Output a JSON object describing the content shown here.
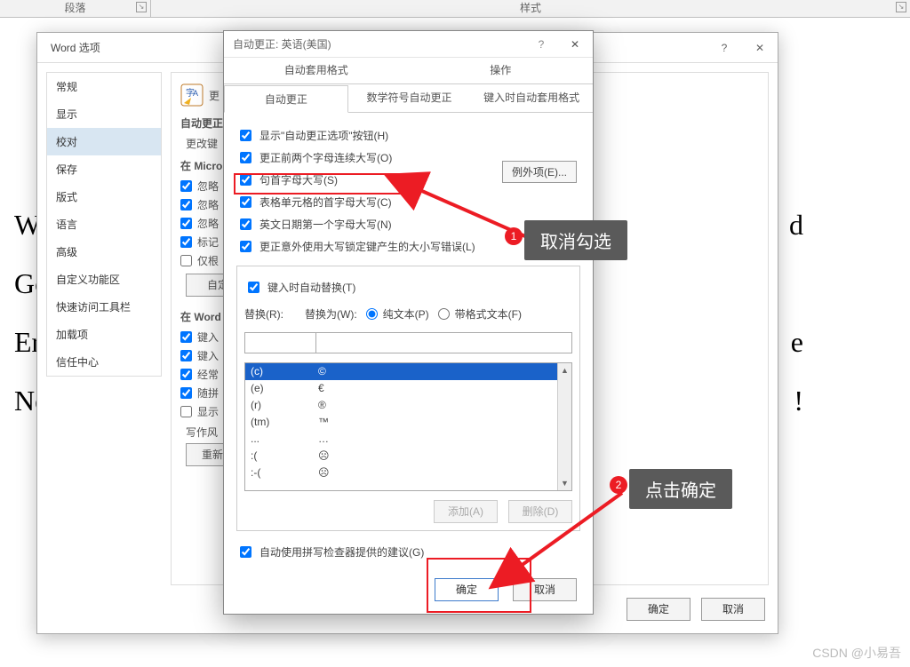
{
  "ribbon": {
    "group1": "段落",
    "group2": "样式"
  },
  "doc_lines": "W\nGo\nEr\nNe",
  "doc_right": "d\n\ne\n!",
  "opt": {
    "title": "Word 选项",
    "nav": [
      "常规",
      "显示",
      "校对",
      "保存",
      "版式",
      "语言",
      "高级",
      "自定义功能区",
      "快速访问工具栏",
      "加载项",
      "信任中心"
    ],
    "sel_index": 2,
    "hdr_text": "更",
    "sec1": "自动更正",
    "sec1_btn": "更改键",
    "sec2": "在 Micro",
    "chk2": [
      "忽略",
      "忽略",
      "忽略",
      "标记",
      "仅根"
    ],
    "sec2_btn": "自定",
    "sec3": "在 Word",
    "chk3": [
      "键入",
      "键入",
      "经常",
      "随拼",
      "显示"
    ],
    "sec3_lbl": "写作风",
    "sec3_btn": "重新检",
    "ok": "确定",
    "cancel": "取消"
  },
  "ac": {
    "title": "自动更正: 英语(美国)",
    "top_tabs": [
      "自动套用格式",
      "操作"
    ],
    "sub_tabs": [
      "自动更正",
      "数学符号自动更正",
      "键入时自动套用格式"
    ],
    "sub_sel": 0,
    "opts": [
      "显示\"自动更正选项\"按钮(H)",
      "更正前两个字母连续大写(O)",
      "句首字母大写(S)",
      "表格单元格的首字母大写(C)",
      "英文日期第一个字母大写(N)",
      "更正意外使用大写锁定键产生的大小写错误(L)"
    ],
    "exceptions": "例外项(E)...",
    "replace_on": "键入时自动替换(T)",
    "replace_lbl": "替换(R):",
    "with_lbl": "替换为(W):",
    "plain": "纯文本(P)",
    "formatted": "带格式文本(F)",
    "table": [
      {
        "k": "(c)",
        "v": "©"
      },
      {
        "k": "(e)",
        "v": "€"
      },
      {
        "k": "(r)",
        "v": "®"
      },
      {
        "k": "(tm)",
        "v": "™"
      },
      {
        "k": "...",
        "v": "…"
      },
      {
        "k": ":(",
        "v": "☹"
      },
      {
        "k": ":-(",
        "v": "☹"
      }
    ],
    "sel_row": 0,
    "add": "添加(A)",
    "del": "删除(D)",
    "use_spell": "自动使用拼写检查器提供的建议(G)",
    "ok": "确定",
    "cancel": "取消"
  },
  "ann": {
    "c1_num": "1",
    "c1": "取消勾选",
    "c2_num": "2",
    "c2": "点击确定"
  },
  "watermark": "CSDN @小易吾"
}
